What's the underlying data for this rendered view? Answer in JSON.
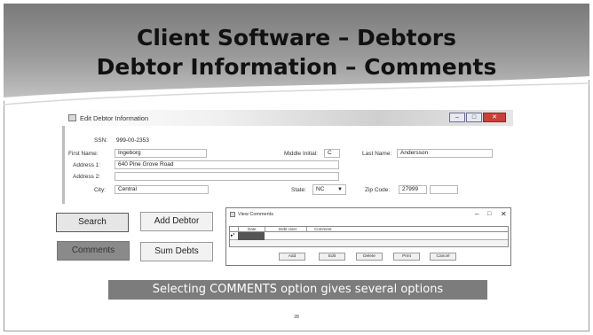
{
  "slide": {
    "title_line1": "Client Software – Debtors",
    "title_line2": "Debtor Information – Comments",
    "caption": "Selecting COMMENTS option gives several options",
    "page_number": "28"
  },
  "edit_window": {
    "title": "Edit Debtor Information",
    "ssn_label": "SSN:",
    "ssn_value": "999-00-2353",
    "first_name_label": "First Name:",
    "first_name_value": "Ingeborg",
    "middle_initial_label": "Middle Initial:",
    "middle_initial_value": "C",
    "last_name_label": "Last Name:",
    "last_name_value": "Andersson",
    "address1_label": "Address 1:",
    "address1_value": "640 Pine Grove Road",
    "address2_label": "Address 2:",
    "address2_value": "",
    "city_label": "City:",
    "city_value": "Central",
    "state_label": "State:",
    "state_value": "NC",
    "zip_label": "Zip Code:",
    "zip_value": "27999",
    "zip_ext_value": ""
  },
  "buttons": {
    "search": "Search",
    "add_debtor": "Add Debtor",
    "comments": "Comments",
    "sum_debts": "Sum Debts"
  },
  "comments_window": {
    "title": "View Comments",
    "columns": [
      "Date",
      "Debt User",
      "Comment"
    ],
    "row_marker": "▸*",
    "actions": [
      "Add",
      "Edit",
      "Delete",
      "Print",
      "Cancel"
    ]
  },
  "colors": {
    "header_gray": "#888888",
    "caption_bg": "#7c7c7c",
    "comments_selected": "#8a8a8a",
    "close_red": "#c9403a"
  }
}
